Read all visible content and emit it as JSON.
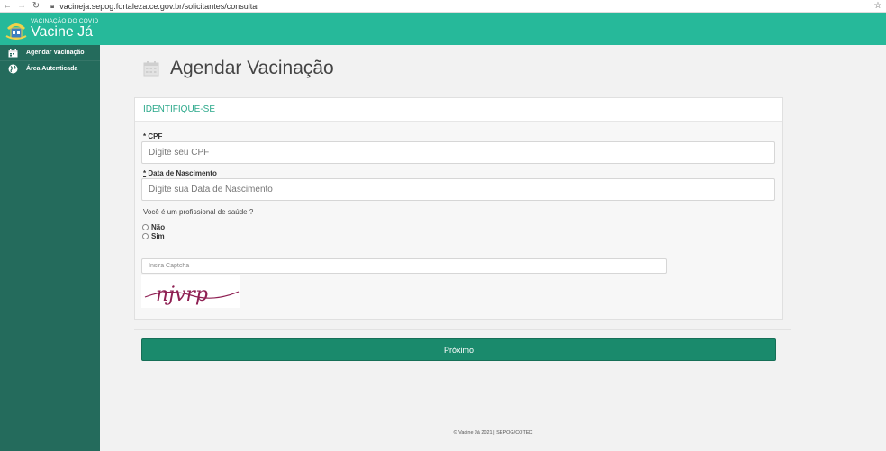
{
  "browser": {
    "url": "vacineja.sepog.fortaleza.ce.gov.br/solicitantes/consultar",
    "icons": [
      "back-arrow-icon",
      "forward-arrow-icon",
      "reload-icon",
      "lock-icon",
      "star-icon"
    ]
  },
  "header": {
    "subtitle": "VACINAÇÃO DO COVID",
    "title": "Vacine Já",
    "color": "#26b99a"
  },
  "sidebar": {
    "color": "#246b5c",
    "items": [
      {
        "label": "Agendar Vacinação",
        "icon": "calendar-icon"
      },
      {
        "label": "Área Autenticada",
        "icon": "globe-icon"
      }
    ]
  },
  "page": {
    "title": "Agendar Vacinação"
  },
  "form": {
    "section_title": "IDENTIFIQUE-SE",
    "cpf": {
      "required_mark": "*",
      "label": "CPF",
      "placeholder": "Digite seu CPF"
    },
    "birth": {
      "required_mark": "*",
      "label": "Data de Nascimento",
      "placeholder": "Digite sua Data de Nascimento"
    },
    "question": "Você é um profissional de saúde ?",
    "options": [
      "Não",
      "Sim"
    ],
    "captcha_placeholder": "Insira Captcha",
    "captcha_text": "njvrp",
    "next_label": "Próximo",
    "accent_color": "#2aa88a",
    "button_color": "#1a8a6c"
  },
  "footer": {
    "text": "© Vacine Já 2021 | SEPOG/COTEC"
  }
}
